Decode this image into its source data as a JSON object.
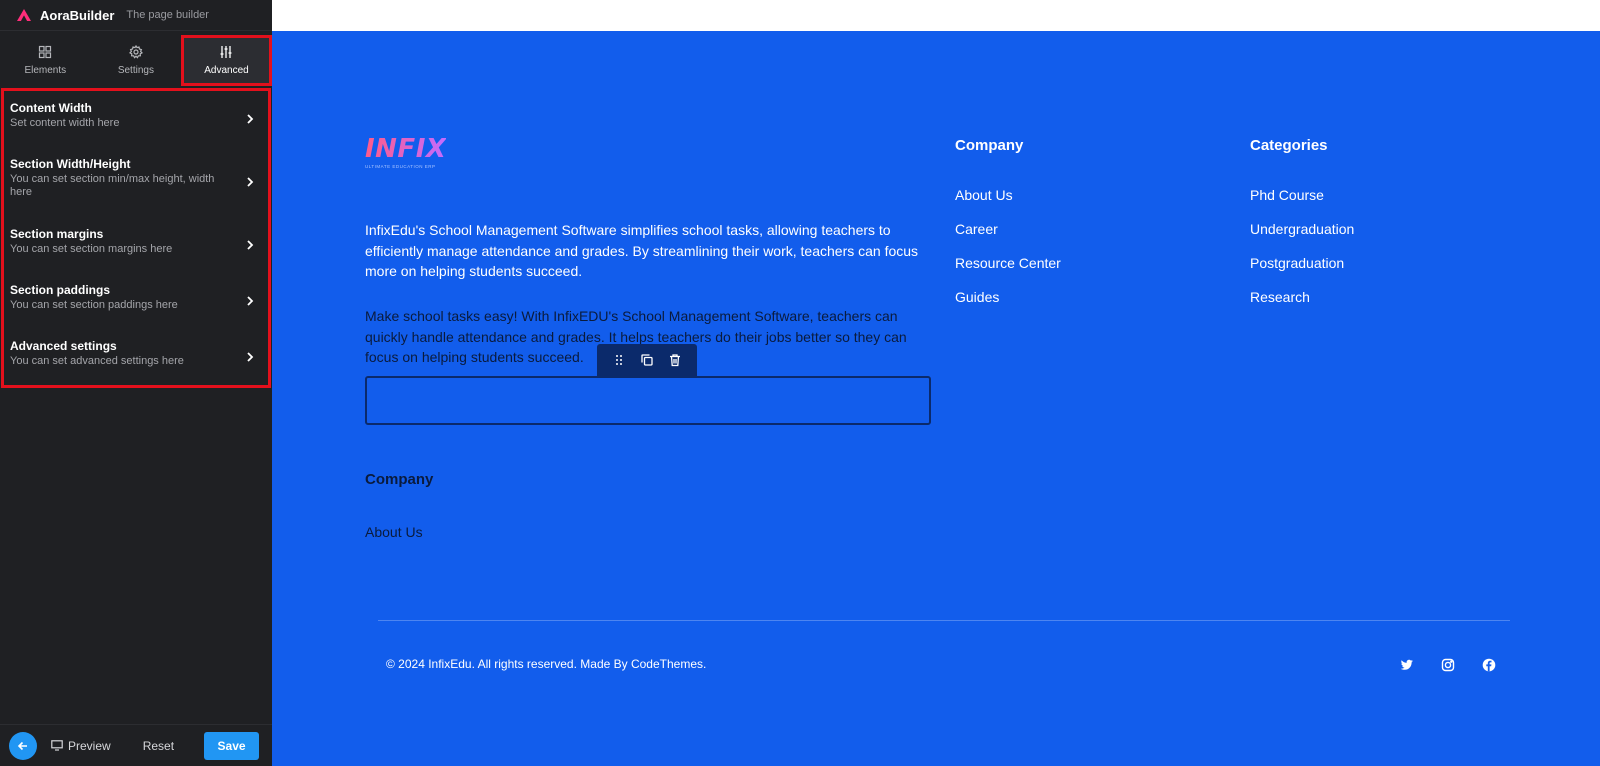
{
  "sidebar": {
    "brand": {
      "name": "AoraBuilder",
      "subtitle": "The page builder"
    },
    "tabs": [
      {
        "label": "Elements",
        "icon": "grid-icon"
      },
      {
        "label": "Settings",
        "icon": "gear-icon"
      },
      {
        "label": "Advanced",
        "icon": "sliders-icon",
        "active": true
      }
    ],
    "items": [
      {
        "title": "Content Width",
        "desc": "Set content width here"
      },
      {
        "title": "Section Width/Height",
        "desc": "You can set section min/max height, width here"
      },
      {
        "title": "Section margins",
        "desc": "You can set section margins here"
      },
      {
        "title": "Section paddings",
        "desc": "You can set section paddings here"
      },
      {
        "title": "Advanced settings",
        "desc": "You can set advanced settings here"
      }
    ],
    "footer": {
      "preview": "Preview",
      "reset": "Reset",
      "save": "Save"
    }
  },
  "canvas": {
    "logo": {
      "text": "INFIX",
      "tagline": "ULTIMATE EDUCATION ERP"
    },
    "paragraph1": "InfixEdu's School Management Software simplifies school tasks, allowing teachers to efficiently manage attendance and grades. By streamlining their work, teachers can focus more on helping students succeed.",
    "paragraph2": "Make school tasks easy! With InfixEDU's School Management Software, teachers can quickly handle attendance and grades. It helps teachers do their jobs better so they can focus on helping students succeed.",
    "company": {
      "heading": "Company",
      "links": [
        "About Us",
        "Career",
        "Resource Center",
        "Guides"
      ]
    },
    "categories": {
      "heading": "Categories",
      "links": [
        "Phd Course",
        "Undergraduation",
        "Postgraduation",
        "Research"
      ]
    },
    "section2": {
      "heading": "Company",
      "link": "About Us"
    },
    "copyright": "© 2024 InfixEdu. All rights reserved. Made By CodeThemes.",
    "socials": [
      "twitter-icon",
      "instagram-icon",
      "facebook-icon"
    ]
  },
  "colors": {
    "accent": "#2196f3",
    "canvas": "#125dec",
    "highlight": "#e3101c",
    "sidebar": "#1f2023"
  }
}
